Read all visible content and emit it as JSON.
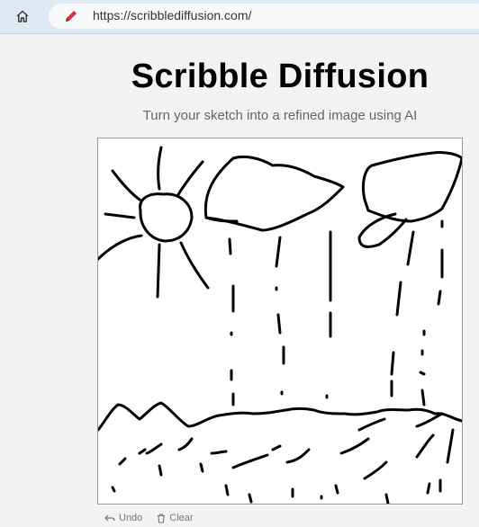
{
  "browser": {
    "url": "https://scribblediffusion.com/"
  },
  "page": {
    "title": "Scribble Diffusion",
    "subtitle": "Turn your sketch into a refined image using AI"
  },
  "toolbar": {
    "undo_label": "Undo",
    "clear_label": "Clear"
  }
}
